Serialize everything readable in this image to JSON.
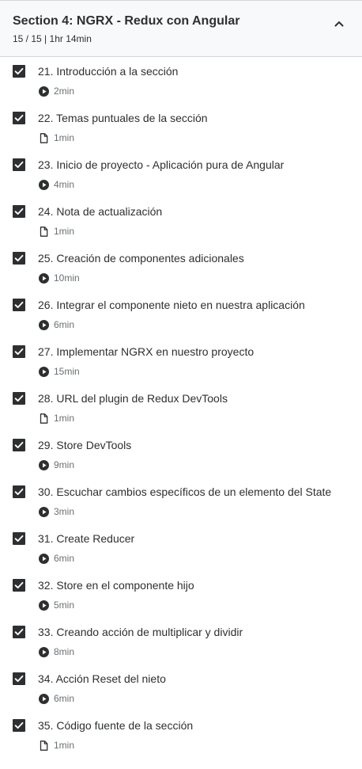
{
  "section": {
    "title": "Section 4: NGRX - Redux con Angular",
    "progress": "15 / 15",
    "separator": "|",
    "total_duration": "1hr 14min",
    "expanded": true
  },
  "lectures": [
    {
      "label": "21. Introducción a la sección",
      "duration": "2min",
      "icon": "play-icon",
      "completed": true
    },
    {
      "label": "22. Temas puntuales de la sección",
      "duration": "1min",
      "icon": "document-icon",
      "completed": true
    },
    {
      "label": "23. Inicio de proyecto - Aplicación pura de Angular",
      "duration": "4min",
      "icon": "play-icon",
      "completed": true
    },
    {
      "label": "24. Nota de actualización",
      "duration": "1min",
      "icon": "document-icon",
      "completed": true
    },
    {
      "label": "25. Creación de componentes adicionales",
      "duration": "10min",
      "icon": "play-icon",
      "completed": true
    },
    {
      "label": "26. Integrar el componente nieto en nuestra aplicación",
      "duration": "6min",
      "icon": "play-icon",
      "completed": true
    },
    {
      "label": "27. Implementar NGRX en nuestro proyecto",
      "duration": "15min",
      "icon": "play-icon",
      "completed": true
    },
    {
      "label": "28. URL del plugin de Redux DevTools",
      "duration": "1min",
      "icon": "document-icon",
      "completed": true
    },
    {
      "label": "29. Store DevTools",
      "duration": "9min",
      "icon": "play-icon",
      "completed": true
    },
    {
      "label": "30. Escuchar cambios específicos de un elemento del State",
      "duration": "3min",
      "icon": "play-icon",
      "completed": true
    },
    {
      "label": "31. Create Reducer",
      "duration": "6min",
      "icon": "play-icon",
      "completed": true
    },
    {
      "label": "32. Store en el componente hijo",
      "duration": "5min",
      "icon": "play-icon",
      "completed": true
    },
    {
      "label": "33. Creando acción de multiplicar y dividir",
      "duration": "8min",
      "icon": "play-icon",
      "completed": true
    },
    {
      "label": "34. Acción Reset del nieto",
      "duration": "6min",
      "icon": "play-icon",
      "completed": true
    },
    {
      "label": "35. Código fuente de la sección",
      "duration": "1min",
      "icon": "document-icon",
      "completed": true
    }
  ]
}
